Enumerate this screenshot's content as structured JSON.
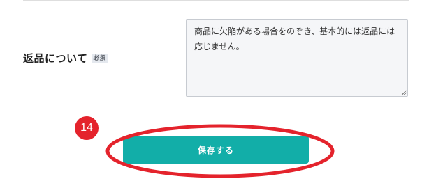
{
  "field": {
    "label": "返品について",
    "required_badge": "必須",
    "value": "商品に欠陥がある場合をのぞき、基本的には返品には応じません。"
  },
  "annotation": {
    "step_number": "14",
    "color": "#e4232c"
  },
  "actions": {
    "save_label": "保存する",
    "save_color": "#12aea8"
  }
}
